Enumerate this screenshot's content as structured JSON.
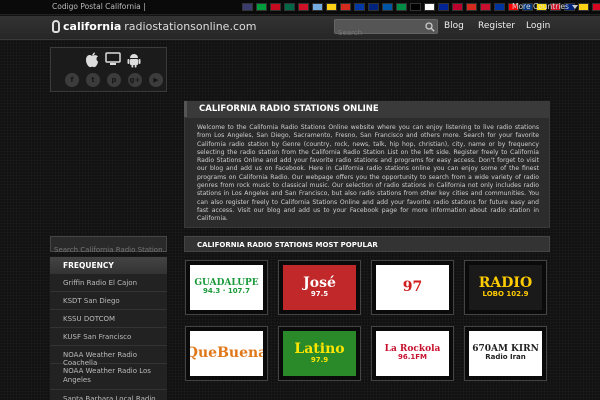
{
  "topbar": {
    "tagline": "Codigo Postal California |",
    "more_label": "More Countries",
    "flags": [
      "#3c3b6e",
      "#009c3b",
      "#c60b1e",
      "#006847",
      "#ce1126",
      "#74acdf",
      "#fcd116",
      "#d52b1e",
      "#0039a6",
      "#00247d",
      "#0055a4",
      "#008c45",
      "#000000",
      "#ffffff",
      "#002395",
      "#bc002d",
      "#d52b1e",
      "#c8102e",
      "#0033a0",
      "#ff0000",
      "#003580",
      "#fedd00",
      "#ce1126",
      "#00247d",
      "#fcd116",
      "#d80621"
    ]
  },
  "header": {
    "logo_bold": "california",
    "logo_light": "radiostationsonline.com",
    "search_placeholder": "Search",
    "nav": {
      "blog": "Blog",
      "register": "Register",
      "login": "Login"
    }
  },
  "sidebar": {
    "os_icons": [
      "apple-icon",
      "android-icon"
    ],
    "social": [
      {
        "name": "facebook-icon",
        "glyph": "f"
      },
      {
        "name": "twitter-icon",
        "glyph": "t"
      },
      {
        "name": "pinterest-icon",
        "glyph": "p"
      },
      {
        "name": "google-plus-icon",
        "glyph": "g+"
      },
      {
        "name": "youtube-icon",
        "glyph": "▶"
      }
    ],
    "search_placeholder": "Search California Radio Station...",
    "frequency_title": "FREQUENCY",
    "frequency_items": [
      "Griffin Radio El Cajon",
      "KSDT San Diego",
      "KSSU DOTCOM",
      "KUSF San Francisco",
      "NOAA Weather Radio Coachella",
      "NOAA Weather Radio Los Angeles",
      "Santa Barbara Local Radio"
    ]
  },
  "main": {
    "intro_title": "CALIFORNIA RADIO STATIONS ONLINE",
    "intro_text": "Welcome to the California Radio Stations Online website where you can enjoy listening to live radio stations from Los Angeles, San Diego, Sacramento, Fresno, San Francisco and others more. Search for your favorite California radio station by Genre (country, rock, news, talk, hip hop, christian), city, name or by frequency selecting the radio station from the California Radio Station List on the left side. Register freely to California Radio Stations Online and add your favorite radio stations and programs for easy access. Don't forget to visit our blog and add us on Facebook. Here in California radio stations online you can enjoy some of the finest programs on California Radio. Our webpage offers you the opportunity to search from a wide variety of radio genres from rock music to classical music. Our selection of radio stations in California not only includes radio stations in Los Angeles and San Francisco, but also radio stations from other key cities and communities. You can also register freely to California Stations Online and add your favorite radio stations for future easy and fast access. Visit our blog and add us to your Facebook page for more information about radio station in California.",
    "popular_title": "CALIFORNIA RADIO STATIONS MOST POPULAR",
    "stations": [
      {
        "name": "Guadalupe Radio",
        "line1": "GUADALUPE",
        "line2": "94.3 · 107.7",
        "color": "#1a9a3a",
        "bg": "#ffffff"
      },
      {
        "name": "Jose 97.5",
        "line1": "José",
        "line2": "97.5",
        "color": "#ffffff",
        "bg": "#c0282a"
      },
      {
        "name": "97",
        "line1": "97",
        "line2": "",
        "color": "#d01b1b",
        "bg": "#ffffff"
      },
      {
        "name": "Radio Lobo 102.9",
        "line1": "RADIO",
        "line2": "LOBO 102.9",
        "color": "#ffcc00",
        "bg": "#1a1a1a"
      },
      {
        "name": "Que Buena",
        "line1": "QueBuena",
        "line2": "",
        "color": "#e0781a",
        "bg": "#ffffff"
      },
      {
        "name": "Latino 97.9",
        "line1": "Latino",
        "line2": "97.9",
        "color": "#ffe600",
        "bg": "#2a8a2a"
      },
      {
        "name": "La Rockola 96.1 FM",
        "line1": "La Rockola",
        "line2": "96.1FM",
        "color": "#c8102e",
        "bg": "#ffffff"
      },
      {
        "name": "670AM KIRN Radio Iran",
        "line1": "670AM KIRN",
        "line2": "Radio Iran",
        "color": "#222222",
        "bg": "#ffffff"
      }
    ]
  }
}
